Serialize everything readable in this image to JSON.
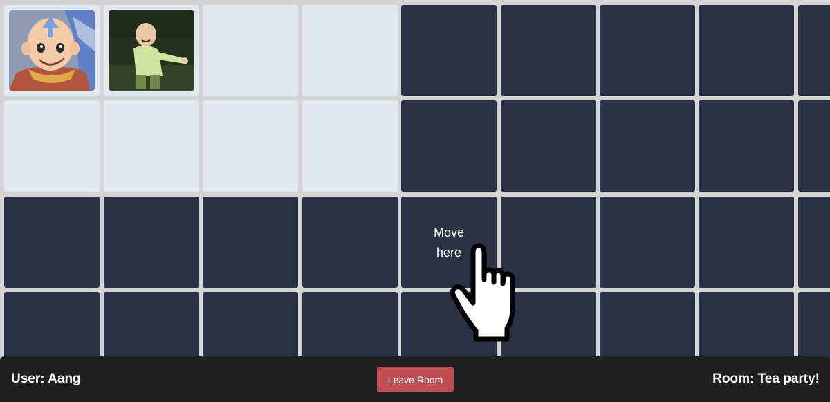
{
  "board": {
    "rows": [
      [
        {
          "shade": "light",
          "occupant": "aang"
        },
        {
          "shade": "light",
          "occupant": "toph"
        },
        {
          "shade": "light"
        },
        {
          "shade": "light"
        },
        {
          "shade": "dark"
        },
        {
          "shade": "dark"
        },
        {
          "shade": "dark"
        },
        {
          "shade": "dark"
        },
        {
          "shade": "dark"
        }
      ],
      [
        {
          "shade": "light"
        },
        {
          "shade": "light"
        },
        {
          "shade": "light"
        },
        {
          "shade": "light"
        },
        {
          "shade": "dark"
        },
        {
          "shade": "dark"
        },
        {
          "shade": "dark"
        },
        {
          "shade": "dark"
        },
        {
          "shade": "dark"
        }
      ],
      [
        {
          "shade": "dark"
        },
        {
          "shade": "dark"
        },
        {
          "shade": "dark"
        },
        {
          "shade": "dark"
        },
        {
          "shade": "dark"
        },
        {
          "shade": "dark"
        },
        {
          "shade": "dark"
        },
        {
          "shade": "dark"
        },
        {
          "shade": "dark"
        }
      ],
      [
        {
          "shade": "dark"
        },
        {
          "shade": "dark"
        },
        {
          "shade": "dark"
        },
        {
          "shade": "dark"
        },
        {
          "shade": "dark"
        },
        {
          "shade": "dark"
        },
        {
          "shade": "dark"
        },
        {
          "shade": "dark"
        },
        {
          "shade": "dark"
        }
      ]
    ]
  },
  "hint": {
    "line1": "Move",
    "line2": "here",
    "cursor_icon": "pointing-hand-icon"
  },
  "footer": {
    "user_text": "User: Aang",
    "leave_label": "Leave Room",
    "room_text": "Room: Tea party!"
  },
  "colors": {
    "light_cell": "#e1e8f1",
    "dark_cell": "#293244",
    "grid_lines": "#d4d4d4",
    "footer_bg": "#202020",
    "leave_button": "#bf4f55"
  }
}
